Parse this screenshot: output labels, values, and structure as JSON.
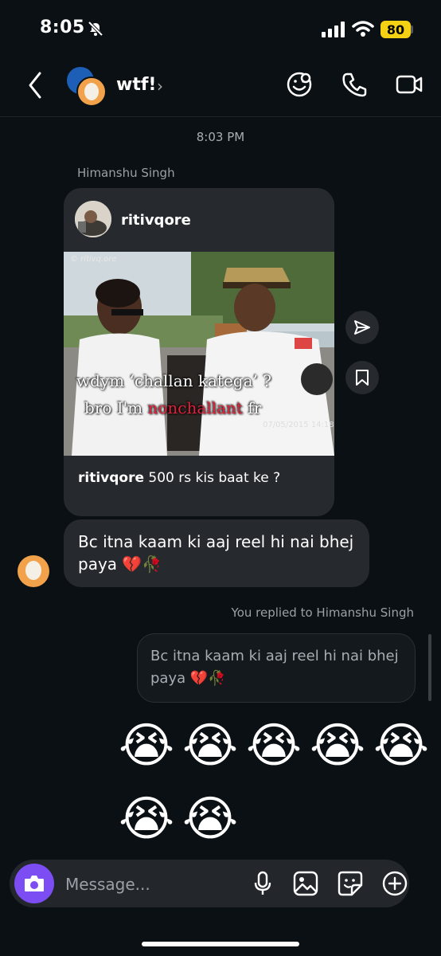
{
  "status_bar": {
    "time": "8:05",
    "battery": "80"
  },
  "header": {
    "title": "wtf!",
    "chevron": "›"
  },
  "conversation": {
    "timestamp": "8:03 PM",
    "sender_name": "Himanshu Singh",
    "shared_post": {
      "username": "ritivqore",
      "watermark": "© ritivq.ore",
      "video_date": "07/05/2015 14:18",
      "overlay_line1": "wdym ‘challan katega’ ?",
      "overlay_line2_prefix": "bro I'm ",
      "overlay_line2_highlight": "nonchallant",
      "overlay_line2_suffix": " fr",
      "caption_user": "ritivqore",
      "caption_text": " 500 rs kis baat ke ?"
    },
    "incoming_message": "Bc itna kaam ki aaj reel hi nai bhej paya 💔🥀",
    "reply_note": "You replied to Himanshu Singh",
    "reply_quote": "Bc itna kaam ki aaj reel hi nai bhej paya 💔🥀",
    "emoji_reactions": [
      "😭",
      "😭",
      "😭",
      "😭",
      "😭",
      "😭",
      "😭"
    ]
  },
  "composer": {
    "placeholder": "Message..."
  },
  "icons": {
    "back": "chevron-left-icon",
    "theme": "sticker-face-icon",
    "call": "phone-icon",
    "video": "video-camera-icon",
    "send": "paper-plane-icon",
    "save": "bookmark-icon",
    "camera": "camera-icon",
    "mic": "microphone-icon",
    "gallery": "image-icon",
    "sticker": "sticker-icon",
    "plus": "plus-circle-icon"
  },
  "colors": {
    "accent": "#7b4df3",
    "battery": "#f5d113",
    "highlight_red": "#e3213a",
    "bubble": "#262a2f",
    "background": "#0b1014"
  }
}
